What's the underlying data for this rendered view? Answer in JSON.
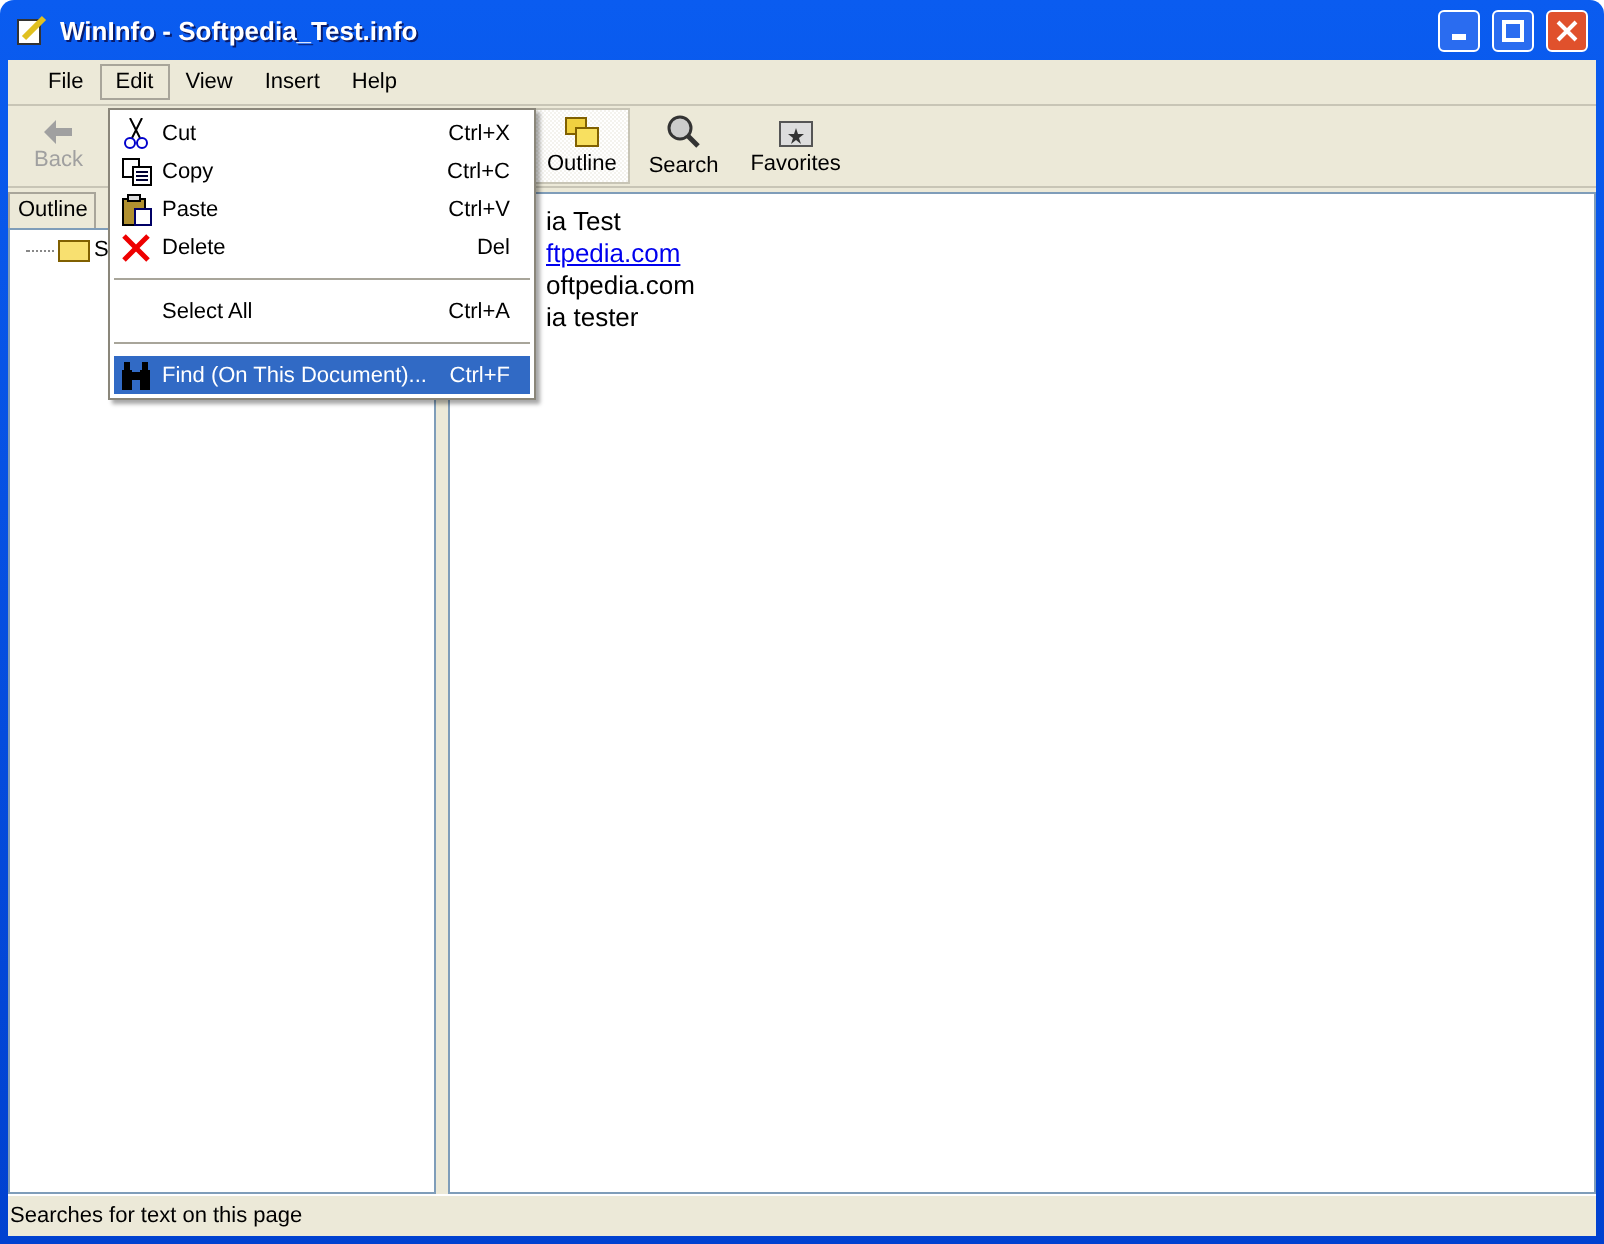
{
  "window": {
    "title": "WinInfo - Softpedia_Test.info"
  },
  "menu_bar": [
    {
      "label": "File",
      "selected": false
    },
    {
      "label": "Edit",
      "selected": true
    },
    {
      "label": "View",
      "selected": false
    },
    {
      "label": "Insert",
      "selected": false
    },
    {
      "label": "Help",
      "selected": false
    }
  ],
  "toolbar": [
    {
      "label": "Back",
      "kind": "back",
      "disabled": true,
      "selected": false
    },
    {
      "label": "Outline",
      "kind": "outline",
      "disabled": false,
      "selected": true
    },
    {
      "label": "Search",
      "kind": "search",
      "disabled": false,
      "selected": false
    },
    {
      "label": "Favorites",
      "kind": "favorites",
      "disabled": false,
      "selected": false
    }
  ],
  "edit_menu": [
    {
      "kind": "cut",
      "label": "Cut",
      "shortcut": "Ctrl+X",
      "selected": false
    },
    {
      "kind": "copy",
      "label": "Copy",
      "shortcut": "Ctrl+C",
      "selected": false
    },
    {
      "kind": "paste",
      "label": "Paste",
      "shortcut": "Ctrl+V",
      "selected": false
    },
    {
      "kind": "delete",
      "label": "Delete",
      "shortcut": "Del",
      "selected": false
    },
    {
      "kind": "separator"
    },
    {
      "kind": "plain",
      "label": "Select All",
      "shortcut": "Ctrl+A",
      "selected": false
    },
    {
      "kind": "separator"
    },
    {
      "kind": "find",
      "label": "Find (On This Document)...",
      "shortcut": "Ctrl+F",
      "selected": true
    }
  ],
  "left_pane": {
    "tab": "Outline",
    "tree": [
      {
        "label": "S"
      }
    ]
  },
  "document": [
    {
      "text": "ia Test",
      "kind": "text"
    },
    {
      "text": "ftpedia.com",
      "kind": "link"
    },
    {
      "text": "oftpedia.com",
      "kind": "text"
    },
    {
      "text": "ia tester",
      "kind": "text"
    }
  ],
  "status_bar": "Searches for text on this page"
}
